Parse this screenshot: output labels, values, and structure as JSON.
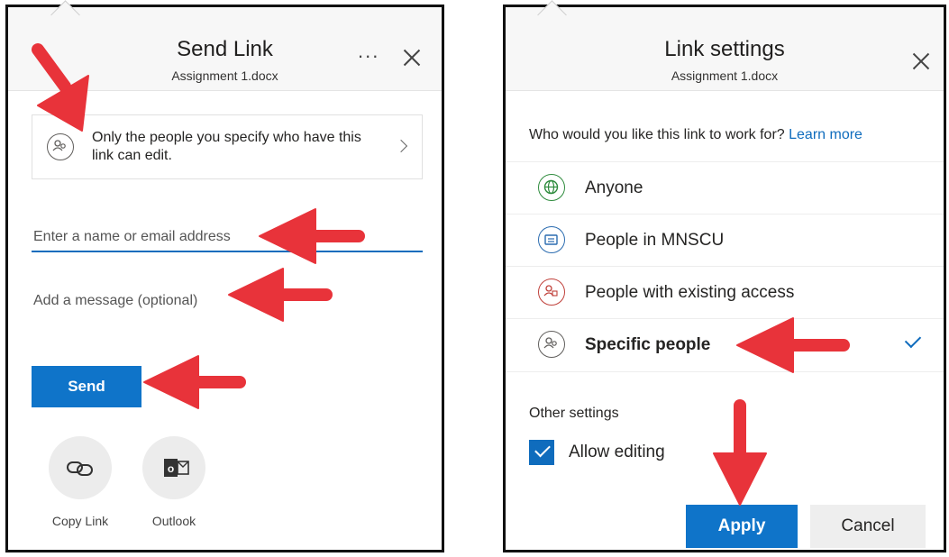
{
  "left_panel": {
    "title": "Send Link",
    "subtitle": "Assignment 1.docx",
    "more_label": "...",
    "permission_text": "Only the people you specify who have this link can edit.",
    "name_placeholder": "Enter a name or email address",
    "message_placeholder": "Add a message (optional)",
    "send_label": "Send",
    "share_options": [
      {
        "label": "Copy Link",
        "icon": "link-icon"
      },
      {
        "label": "Outlook",
        "icon": "outlook-icon"
      }
    ]
  },
  "right_panel": {
    "title": "Link settings",
    "subtitle": "Assignment 1.docx",
    "question": "Who would you like this link to work for?",
    "learn_more": "Learn more",
    "options": [
      {
        "label": "Anyone",
        "icon": "globe-icon",
        "color": "#2e8b3d",
        "selected": false
      },
      {
        "label": "People in MNSCU",
        "icon": "building-icon",
        "color": "#2b6cb0",
        "selected": false
      },
      {
        "label": "People with existing access",
        "icon": "people-lock-icon",
        "color": "#c0403a",
        "selected": false
      },
      {
        "label": "Specific people",
        "icon": "people-icon",
        "color": "#605e5c",
        "selected": true
      }
    ],
    "other_settings_label": "Other settings",
    "allow_editing_label": "Allow editing",
    "allow_editing_checked": true,
    "apply_label": "Apply",
    "cancel_label": "Cancel"
  },
  "colors": {
    "accent": "#0f74c9",
    "annotation_arrow": "#e8333a"
  }
}
